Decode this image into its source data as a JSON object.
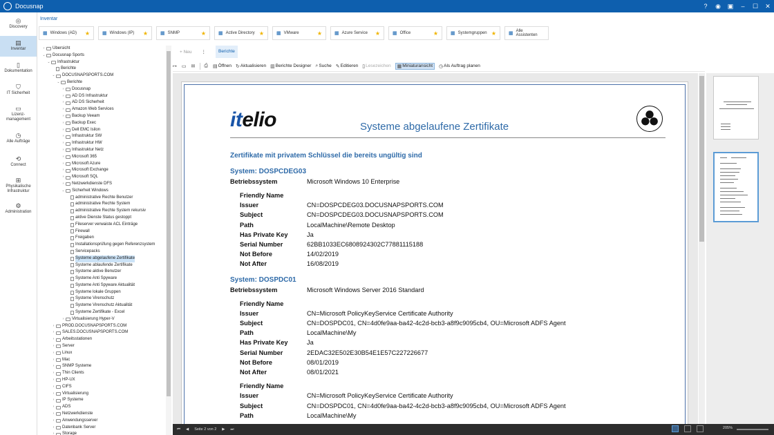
{
  "app": {
    "title": "Docusnap"
  },
  "nav": [
    {
      "label": "Discovery",
      "icon": "compass-icon"
    },
    {
      "label": "Inventar",
      "icon": "inventory-icon",
      "active": true
    },
    {
      "label": "Dokumentation",
      "icon": "document-icon"
    },
    {
      "label": "IT Sicherheit",
      "icon": "shield-icon"
    },
    {
      "label": "Lizenz-management",
      "icon": "license-icon"
    },
    {
      "label": "Alle Aufträge",
      "icon": "clock-icon"
    },
    {
      "label": "Connect",
      "icon": "connect-icon"
    },
    {
      "label": "Physikalische Infrastruktur",
      "icon": "network-icon"
    },
    {
      "label": "Administration",
      "icon": "gear-icon"
    }
  ],
  "inventory_label": "Inventar",
  "quickbar": [
    {
      "label": "Windows (AD)",
      "width": 80
    },
    {
      "label": "Windows (IP)",
      "width": 78
    },
    {
      "label": "SNMP",
      "width": 78
    },
    {
      "label": "Active Directory",
      "width": 78
    },
    {
      "label": "VMware",
      "width": 78
    },
    {
      "label": "Azure Service",
      "width": 78
    },
    {
      "label": "Office",
      "width": 78
    },
    {
      "label": "Systemgruppen",
      "width": 78
    },
    {
      "label": "Alle Assistenten",
      "width": 64
    }
  ],
  "tree": [
    {
      "label": "Übersicht",
      "depth": 0,
      "exp": "›"
    },
    {
      "label": "Docusnap Sports",
      "depth": 0,
      "exp": "⌄"
    },
    {
      "label": "Infrastruktur",
      "depth": 1,
      "exp": "⌄"
    },
    {
      "label": "Berichte",
      "depth": 2,
      "exp": ""
    },
    {
      "label": "DOCUSNAPSPORTS.COM",
      "depth": 2,
      "exp": "⌄"
    },
    {
      "label": "Berichte",
      "depth": 3,
      "exp": "⌄"
    },
    {
      "label": "Docusnap",
      "depth": 4,
      "exp": "›"
    },
    {
      "label": "AD DS Infrastruktur",
      "depth": 4,
      "exp": "›"
    },
    {
      "label": "AD DS Sicherheit",
      "depth": 4,
      "exp": "›"
    },
    {
      "label": "Amazon Web Services",
      "depth": 4,
      "exp": "›"
    },
    {
      "label": "Backup Veeam",
      "depth": 4,
      "exp": "›"
    },
    {
      "label": "Backup Exec",
      "depth": 4,
      "exp": "›"
    },
    {
      "label": "Dell EMC Isilon",
      "depth": 4,
      "exp": "›"
    },
    {
      "label": "Infrastruktur SW",
      "depth": 4,
      "exp": "›"
    },
    {
      "label": "Infrastruktur HW",
      "depth": 4,
      "exp": "›"
    },
    {
      "label": "Infrastruktur Netz",
      "depth": 4,
      "exp": "›"
    },
    {
      "label": "Microsoft 365",
      "depth": 4,
      "exp": "›"
    },
    {
      "label": "Microsoft Azure",
      "depth": 4,
      "exp": "›"
    },
    {
      "label": "Microsoft Exchange",
      "depth": 4,
      "exp": "›"
    },
    {
      "label": "Microsoft SQL",
      "depth": 4,
      "exp": "›"
    },
    {
      "label": "Netzwerkdienste DFS",
      "depth": 4,
      "exp": "›"
    },
    {
      "label": "Sicherheit Windows",
      "depth": 4,
      "exp": "⌄"
    },
    {
      "label": "administrative Rechte Benutzer",
      "depth": 5,
      "exp": ""
    },
    {
      "label": "administrative Rechte System",
      "depth": 5,
      "exp": ""
    },
    {
      "label": "administrative Rechte System rekursiv",
      "depth": 5,
      "exp": ""
    },
    {
      "label": "aktive Dienste Status gestoppt",
      "depth": 5,
      "exp": ""
    },
    {
      "label": "Fileserver verwaiste ACL Einträge",
      "depth": 5,
      "exp": ""
    },
    {
      "label": "Firewall",
      "depth": 5,
      "exp": ""
    },
    {
      "label": "Freigaben",
      "depth": 5,
      "exp": ""
    },
    {
      "label": "Installationsprüfung gegen Referenzsystem",
      "depth": 5,
      "exp": ""
    },
    {
      "label": "Servicepacks",
      "depth": 5,
      "exp": ""
    },
    {
      "label": "Systeme abgelaufene Zertifikate",
      "depth": 5,
      "exp": "",
      "selected": true
    },
    {
      "label": "Systeme ablaufende Zertifikate",
      "depth": 5,
      "exp": ""
    },
    {
      "label": "Systeme aktive Benutzer",
      "depth": 5,
      "exp": ""
    },
    {
      "label": "Systeme Anti Spyware",
      "depth": 5,
      "exp": ""
    },
    {
      "label": "Systeme Anti Spyware Aktualität",
      "depth": 5,
      "exp": ""
    },
    {
      "label": "Systeme lokale Gruppen",
      "depth": 5,
      "exp": ""
    },
    {
      "label": "Systeme Virenschutz",
      "depth": 5,
      "exp": ""
    },
    {
      "label": "Systeme Virenschutz Aktualität",
      "depth": 5,
      "exp": ""
    },
    {
      "label": "Systeme Zertifikate - Excel",
      "depth": 5,
      "exp": ""
    },
    {
      "label": "Virtualisierung Hyper-V",
      "depth": 4,
      "exp": "›"
    },
    {
      "label": "PROD.DOCUSNAPSPORTS.COM",
      "depth": 2,
      "exp": "›"
    },
    {
      "label": "SALES.DOCUSNAPSPORTS.COM",
      "depth": 2,
      "exp": "›"
    },
    {
      "label": "Arbeitsstationen",
      "depth": 2,
      "exp": "›"
    },
    {
      "label": "Server",
      "depth": 2,
      "exp": "›"
    },
    {
      "label": "Linux",
      "depth": 2,
      "exp": "›"
    },
    {
      "label": "Mac",
      "depth": 2,
      "exp": "›"
    },
    {
      "label": "SNMP Systeme",
      "depth": 2,
      "exp": "›"
    },
    {
      "label": "Thin Clients",
      "depth": 2,
      "exp": "›"
    },
    {
      "label": "HP-UX",
      "depth": 2,
      "exp": "›"
    },
    {
      "label": "CIFS",
      "depth": 2,
      "exp": "›"
    },
    {
      "label": "Virtualisierung",
      "depth": 2,
      "exp": "›"
    },
    {
      "label": "IP Systeme",
      "depth": 2,
      "exp": "›"
    },
    {
      "label": "ADS",
      "depth": 2,
      "exp": "›"
    },
    {
      "label": "Netzwerkdienste",
      "depth": 2,
      "exp": "›"
    },
    {
      "label": "Anwendungsserver",
      "depth": 2,
      "exp": "›"
    },
    {
      "label": "Datenbank Server",
      "depth": 2,
      "exp": "›"
    },
    {
      "label": "Storage",
      "depth": 2,
      "exp": "›"
    }
  ],
  "toolbar1": {
    "new": "Neu",
    "more": "⋮",
    "tab": "Berichte"
  },
  "toolbar2": {
    "open": "Öffnen",
    "refresh": "Aktualisieren",
    "designer": "Berichte Designer",
    "search": "Suche",
    "edit": "Editieren",
    "bookmarks": "Lesezeichen",
    "thumbnails": "Miniaturansicht",
    "schedule": "Als Auftrag planen"
  },
  "report": {
    "brand_a": "it",
    "brand_b": "elio",
    "title": "Systeme abgelaufene Zertifikate",
    "subtitle": "Zertifikate mit privatem Schlüssel die bereits ungültig sind",
    "sections": [
      {
        "system": "System: DOSPCDEG03",
        "os_label": "Betriebssystem",
        "os": "Microsoft Windows 10 Enterprise",
        "certs": [
          [
            {
              "k": "Friendly Name",
              "v": ""
            },
            {
              "k": "Issuer",
              "v": "CN=DOSPCDEG03.DOCUSNAPSPORTS.COM"
            },
            {
              "k": "Subject",
              "v": "CN=DOSPCDEG03.DOCUSNAPSPORTS.COM"
            },
            {
              "k": "Path",
              "v": "LocalMachine\\Remote Desktop"
            },
            {
              "k": "Has Private Key",
              "v": "Ja"
            },
            {
              "k": "Serial Number",
              "v": "62BB1033EC6808924302C77881115188"
            },
            {
              "k": "Not Before",
              "v": "14/02/2019"
            },
            {
              "k": "Not After",
              "v": "16/08/2019"
            }
          ]
        ]
      },
      {
        "system": "System: DOSPDC01",
        "os_label": "Betriebssystem",
        "os": "Microsoft Windows Server 2016 Standard",
        "certs": [
          [
            {
              "k": "Friendly Name",
              "v": ""
            },
            {
              "k": "Issuer",
              "v": "CN=Microsoft PolicyKeyService Certificate Authority"
            },
            {
              "k": "Subject",
              "v": "CN=DOSPDC01, CN=4d0fe9aa-ba42-4c2d-bcb3-a8f9c9095cb4, OU=Microsoft ADFS Agent"
            },
            {
              "k": "Path",
              "v": "LocalMachine\\My"
            },
            {
              "k": "Has Private Key",
              "v": "Ja"
            },
            {
              "k": "Serial Number",
              "v": "2EDAC32E502E30B54E1E57C227226677"
            },
            {
              "k": "Not Before",
              "v": "08/01/2019"
            },
            {
              "k": "Not After",
              "v": "08/01/2021"
            }
          ],
          [
            {
              "k": "Friendly Name",
              "v": ""
            },
            {
              "k": "Issuer",
              "v": "CN=Microsoft PolicyKeyService Certificate Authority"
            },
            {
              "k": "Subject",
              "v": "CN=DOSPDC01, CN=4d0fe9aa-ba42-4c2d-bcb3-a8f9c9095cb4, OU=Microsoft ADFS Agent"
            },
            {
              "k": "Path",
              "v": "LocalMachine\\My"
            }
          ]
        ]
      }
    ]
  },
  "statusbar": {
    "page": "Seite 2 von 2",
    "zoom": "205%"
  }
}
